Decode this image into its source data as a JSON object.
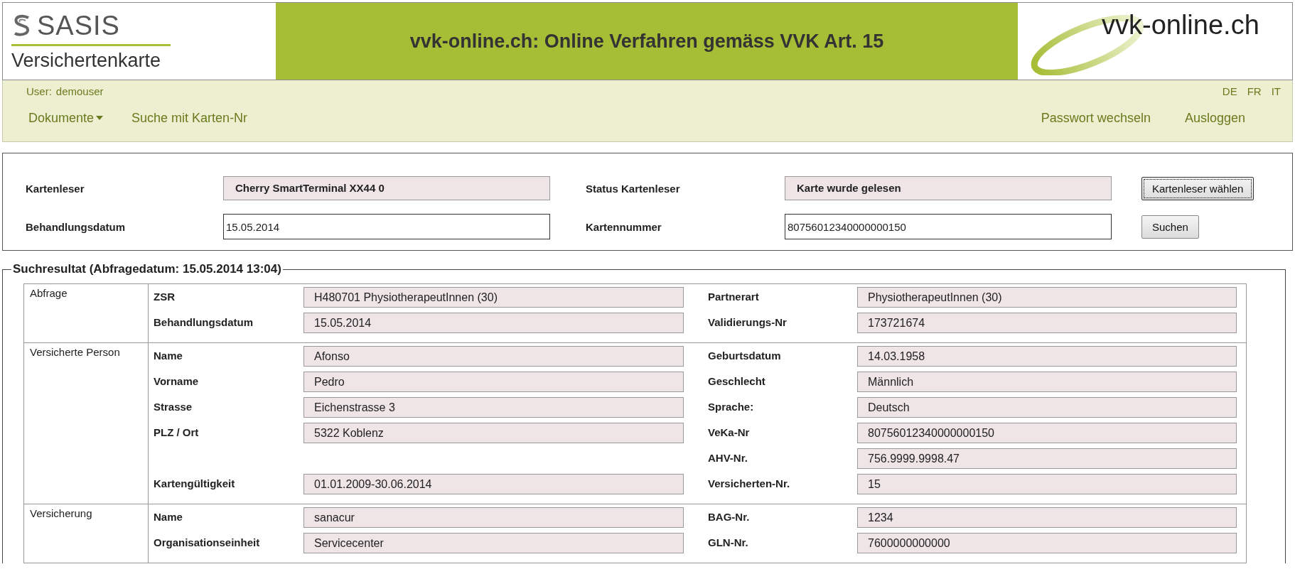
{
  "header": {
    "logo_text": "SASIS",
    "logo_subtitle": "Versichertenkarte",
    "title": "vvk-online.ch: Online Verfahren gemäss VVK Art. 15",
    "brand": "vvk-online.ch"
  },
  "user_bar": {
    "user_label": "User:",
    "username": "demouser",
    "languages": [
      {
        "label": "DE"
      },
      {
        "label": "FR"
      },
      {
        "label": "IT"
      }
    ]
  },
  "nav": {
    "left": [
      {
        "label": "Dokumente",
        "kind": "dropdown"
      },
      {
        "label": "Suche mit Karten-Nr",
        "kind": "link"
      }
    ],
    "right": [
      {
        "label": "Passwort wechseln",
        "kind": "link"
      },
      {
        "label": "Ausloggen",
        "kind": "link"
      }
    ]
  },
  "reader_form": {
    "rows": [
      {
        "left": {
          "label": "Kartenleser",
          "value": "Cherry SmartTerminal XX44 0",
          "kind": "readonly"
        },
        "right": {
          "label": "Status Kartenleser",
          "value": "Karte wurde gelesen",
          "kind": "readonly"
        },
        "button": {
          "label": "Kartenleser wählen",
          "focused": true
        }
      },
      {
        "left": {
          "label": "Behandlungsdatum",
          "value": "15.05.2014",
          "kind": "input"
        },
        "right": {
          "label": "Kartennummer",
          "value": "80756012340000000150",
          "kind": "input"
        },
        "button": {
          "label": "Suchen",
          "focused": false
        }
      }
    ]
  },
  "results": {
    "legend": "Suchresultat (Abfragedatum: 15.05.2014 13:04)",
    "sections": [
      {
        "category": "Abfrage",
        "rows": [
          {
            "left": {
              "label": "ZSR",
              "value": "H480701 PhysiotherapeutInnen (30)"
            },
            "right": {
              "label": "Partnerart",
              "value": "PhysiotherapeutInnen (30)"
            }
          },
          {
            "left": {
              "label": "Behandlungsdatum",
              "value": "15.05.2014"
            },
            "right": {
              "label": "Validierungs-Nr",
              "value": "173721674"
            }
          }
        ]
      },
      {
        "category": "Versicherte Person",
        "rows": [
          {
            "left": {
              "label": "Name",
              "value": "Afonso"
            },
            "right": {
              "label": "Geburtsdatum",
              "value": "14.03.1958"
            }
          },
          {
            "left": {
              "label": "Vorname",
              "value": "Pedro"
            },
            "right": {
              "label": "Geschlecht",
              "value": "Männlich"
            }
          },
          {
            "left": {
              "label": "Strasse",
              "value": "Eichenstrasse 3"
            },
            "right": {
              "label": "Sprache:",
              "value": "Deutsch"
            }
          },
          {
            "left": {
              "label": "PLZ / Ort",
              "value": "5322 Koblenz"
            },
            "right": {
              "label": "VeKa-Nr",
              "value": "80756012340000000150"
            }
          },
          {
            "left": null,
            "right": {
              "label": "AHV-Nr.",
              "value": "756.9999.9998.47"
            }
          },
          {
            "left": {
              "label": "Kartengültigkeit",
              "value": "01.01.2009-30.06.2014"
            },
            "right": {
              "label": "Versicherten-Nr.",
              "value": "15"
            }
          }
        ]
      },
      {
        "category": "Versicherung",
        "rows": [
          {
            "left": {
              "label": "Name",
              "value": "sanacur"
            },
            "right": {
              "label": "BAG-Nr.",
              "value": "1234"
            }
          },
          {
            "left": {
              "label": "Organisationseinheit",
              "value": "Servicecenter"
            },
            "right": {
              "label": "GLN-Nr.",
              "value": "7600000000000"
            }
          }
        ]
      }
    ]
  }
}
